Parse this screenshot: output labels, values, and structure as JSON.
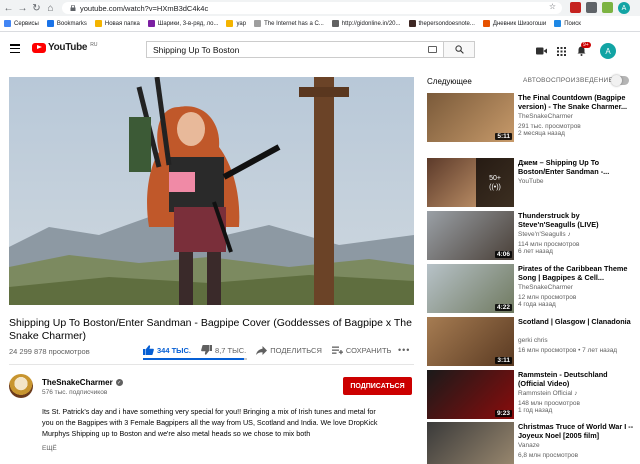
{
  "browser": {
    "url": "youtube.com/watch?v=HXmB3dC4k4c",
    "bookmarks": [
      {
        "label": "Сервисы",
        "color": "#4285f4"
      },
      {
        "label": "Bookmarks",
        "color": "#1a73e8"
      },
      {
        "label": "Новая папка",
        "color": "#f4b400"
      },
      {
        "label": "Шарики, 3-в-ряд, ло...",
        "color": "#7b1fa2"
      },
      {
        "label": "уар",
        "color": "#f4b400"
      },
      {
        "label": "The Internet has a C...",
        "color": "#9e9e9e"
      },
      {
        "label": "http://gidonline.in/20...",
        "color": "#616161"
      },
      {
        "label": "thepersondoesnote...",
        "color": "#3e2723"
      },
      {
        "label": "Дневник Шизогоши",
        "color": "#e65100"
      },
      {
        "label": "Поиск",
        "color": "#1e88e5"
      }
    ],
    "profile_initial": "A"
  },
  "youtube": {
    "logo_text": "YouTube",
    "region": "RU",
    "search_value": "Shipping Up To Boston",
    "notifications": "9+",
    "avatar_initial": "A"
  },
  "video": {
    "title": "Shipping Up To Boston/Enter Sandman - Bagpipe Cover (Goddesses of Bagpipe x The Snake Charmer)",
    "views": "24 299 878 просмотров",
    "likes": "344 ТЫС.",
    "dislikes": "8,7 ТЫС.",
    "share": "ПОДЕЛИТЬСЯ",
    "save": "СОХРАНИТЬ",
    "like_ratio": 0.975
  },
  "channel": {
    "name": "TheSnakeCharmer",
    "subs": "576 тыс. подписчиков",
    "subscribe": "ПОДПИСАТЬСЯ",
    "description": "Its St. Patrick's day and i have something very special for you!! Bringing a mix of Irish tunes and metal for you on the Bagpipes with 3 Female Bagpipers all the way from US, Scotland and India. We love DropKick Murphys Shipping up to Boston and we're also metal heads so we chose to mix both",
    "more": "ЕЩЁ"
  },
  "sidebar": {
    "up_next": "Следующее",
    "autoplay": "АВТОВОСПРОИЗВЕДЕНИЕ",
    "cards": [
      {
        "title": "The Final Countdown (Bagpipe version) - The Snake Charmer...",
        "channel": "TheSnakeCharmer",
        "meta": "291 тыс. просмотров",
        "meta2": "2 месяца назад",
        "duration": "5:11"
      },
      {
        "title": "Джем – Shipping Up To Boston/Enter Sandman -...",
        "channel": "YouTube",
        "meta": "",
        "meta2": "",
        "duration": "",
        "mix": "50+"
      },
      {
        "title": "Thunderstruck by Steve'n'Seagulls (LIVE)",
        "channel": "Steve'n'Seagulls ♪",
        "meta": "114 млн просмотров",
        "meta2": "6 лет назад",
        "duration": "4:06"
      },
      {
        "title": "Pirates of the Caribbean Theme Song | Bagpipes & Cell...",
        "channel": "TheSnakeCharmer",
        "meta": "12 млн просмотров",
        "meta2": "4 года назад",
        "duration": "4:22"
      },
      {
        "title": "Scotland | Glasgow | Clanadonia",
        "channel": "gerki chris",
        "meta": "16 млн просмотров • 7 лет назад",
        "meta2": "",
        "duration": "3:11"
      },
      {
        "title": "Rammstein - Deutschland (Official Video)",
        "channel": "Rammstein Official ♪",
        "meta": "148 млн просмотров",
        "meta2": "1 год назад",
        "duration": "9:23"
      },
      {
        "title": "Christmas Truce of World War I -- Joyeux Noel [2005 film]",
        "channel": "Vanaze",
        "meta": "6,8 млн просмотров",
        "meta2": "",
        "duration": ""
      }
    ]
  }
}
